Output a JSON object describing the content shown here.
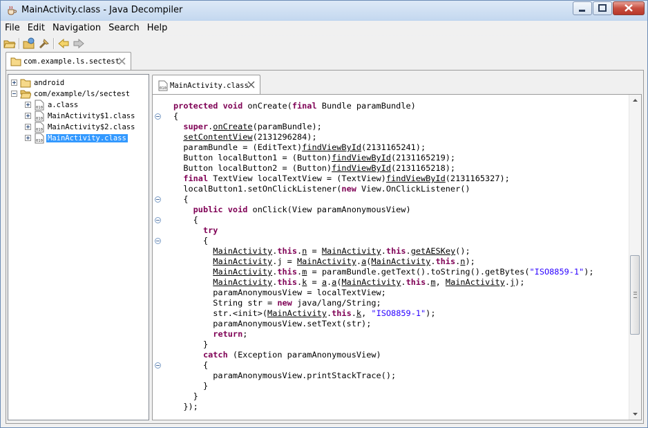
{
  "window": {
    "title": "MainActivity.class - Java Decompiler",
    "minimize_icon": "minimize-icon",
    "maximize_icon": "maximize-icon",
    "close_icon": "close-icon"
  },
  "menu": [
    "File",
    "Edit",
    "Navigation",
    "Search",
    "Help"
  ],
  "toolbar": {
    "icons": [
      "open-file-icon",
      "open-type-icon",
      "find-icon",
      "back-arrow-icon",
      "forward-arrow-icon"
    ]
  },
  "outer_tab": {
    "label": "com.example.ls.sectest"
  },
  "tree": {
    "items": [
      {
        "label": "android",
        "icon": "folder-icon",
        "level": 0,
        "expanded": false,
        "selected": false
      },
      {
        "label": "com/example/ls/sectest",
        "icon": "open-folder-icon",
        "level": 0,
        "expanded": true,
        "selected": false
      },
      {
        "label": "a.class",
        "icon": "class-file-icon",
        "level": 1,
        "expanded": false,
        "selected": false
      },
      {
        "label": "MainActivity$1.class",
        "icon": "class-file-icon",
        "level": 1,
        "expanded": false,
        "selected": false
      },
      {
        "label": "MainActivity$2.class",
        "icon": "class-file-icon",
        "level": 1,
        "expanded": false,
        "selected": false
      },
      {
        "label": "MainActivity.class",
        "icon": "class-file-icon",
        "level": 1,
        "expanded": false,
        "selected": true
      }
    ]
  },
  "editor": {
    "tab_label": "MainActivity.class",
    "fold_lines": [
      1,
      9,
      11,
      13,
      25
    ],
    "code": [
      [
        {
          "t": "protected void",
          "c": "kw"
        },
        {
          "t": " onCreate("
        },
        {
          "t": "final",
          "c": "kw"
        },
        {
          "t": " Bundle paramBundle)"
        }
      ],
      [
        {
          "t": "{"
        }
      ],
      [
        {
          "t": "  "
        },
        {
          "t": "super",
          "c": "kw"
        },
        {
          "t": "."
        },
        {
          "t": "onCreate",
          "c": "link"
        },
        {
          "t": "(paramBundle);"
        }
      ],
      [
        {
          "t": "  "
        },
        {
          "t": "setContentView",
          "c": "link"
        },
        {
          "t": "(2131296284);"
        }
      ],
      [
        {
          "t": "  paramBundle = (EditText)"
        },
        {
          "t": "findViewById",
          "c": "link"
        },
        {
          "t": "(2131165241);"
        }
      ],
      [
        {
          "t": "  Button localButton1 = (Button)"
        },
        {
          "t": "findViewById",
          "c": "link"
        },
        {
          "t": "(2131165219);"
        }
      ],
      [
        {
          "t": "  Button localButton2 = (Button)"
        },
        {
          "t": "findViewById",
          "c": "link"
        },
        {
          "t": "(2131165218);"
        }
      ],
      [
        {
          "t": "  "
        },
        {
          "t": "final",
          "c": "kw"
        },
        {
          "t": " TextView localTextView = (TextView)"
        },
        {
          "t": "findViewById",
          "c": "link"
        },
        {
          "t": "(2131165327);"
        }
      ],
      [
        {
          "t": "  localButton1.setOnClickListener("
        },
        {
          "t": "new",
          "c": "kw"
        },
        {
          "t": " View.OnClickListener()"
        }
      ],
      [
        {
          "t": "  {"
        }
      ],
      [
        {
          "t": "    "
        },
        {
          "t": "public void",
          "c": "kw"
        },
        {
          "t": " onClick(View paramAnonymousView)"
        }
      ],
      [
        {
          "t": "    {"
        }
      ],
      [
        {
          "t": "      "
        },
        {
          "t": "try",
          "c": "kw"
        }
      ],
      [
        {
          "t": "      {"
        }
      ],
      [
        {
          "t": "        "
        },
        {
          "t": "MainActivity",
          "c": "link"
        },
        {
          "t": "."
        },
        {
          "t": "this",
          "c": "kw"
        },
        {
          "t": "."
        },
        {
          "t": "n",
          "c": "link"
        },
        {
          "t": " = "
        },
        {
          "t": "MainActivity",
          "c": "link"
        },
        {
          "t": "."
        },
        {
          "t": "this",
          "c": "kw"
        },
        {
          "t": "."
        },
        {
          "t": "getAESKey",
          "c": "link"
        },
        {
          "t": "();"
        }
      ],
      [
        {
          "t": "        "
        },
        {
          "t": "MainActivity",
          "c": "link"
        },
        {
          "t": ".j = "
        },
        {
          "t": "MainActivity",
          "c": "link"
        },
        {
          "t": "."
        },
        {
          "t": "a",
          "c": "link"
        },
        {
          "t": "("
        },
        {
          "t": "MainActivity",
          "c": "link"
        },
        {
          "t": "."
        },
        {
          "t": "this",
          "c": "kw"
        },
        {
          "t": "."
        },
        {
          "t": "n",
          "c": "link"
        },
        {
          "t": ");"
        }
      ],
      [
        {
          "t": "        "
        },
        {
          "t": "MainActivity",
          "c": "link"
        },
        {
          "t": "."
        },
        {
          "t": "this",
          "c": "kw"
        },
        {
          "t": "."
        },
        {
          "t": "m",
          "c": "link"
        },
        {
          "t": " = paramBundle.getText().toString().getBytes("
        },
        {
          "t": "\"ISO8859-1\"",
          "c": "str"
        },
        {
          "t": ");"
        }
      ],
      [
        {
          "t": "        "
        },
        {
          "t": "MainActivity",
          "c": "link"
        },
        {
          "t": "."
        },
        {
          "t": "this",
          "c": "kw"
        },
        {
          "t": "."
        },
        {
          "t": "k",
          "c": "link"
        },
        {
          "t": " = "
        },
        {
          "t": "a",
          "c": "link"
        },
        {
          "t": "."
        },
        {
          "t": "a",
          "c": "link"
        },
        {
          "t": "("
        },
        {
          "t": "MainActivity",
          "c": "link"
        },
        {
          "t": "."
        },
        {
          "t": "this",
          "c": "kw"
        },
        {
          "t": "."
        },
        {
          "t": "m",
          "c": "link"
        },
        {
          "t": ", "
        },
        {
          "t": "MainActivity",
          "c": "link"
        },
        {
          "t": "."
        },
        {
          "t": "j",
          "c": "link"
        },
        {
          "t": ");"
        }
      ],
      [
        {
          "t": "        paramAnonymousView = localTextView;"
        }
      ],
      [
        {
          "t": "        String str = "
        },
        {
          "t": "new",
          "c": "kw"
        },
        {
          "t": " java/lang/String;"
        }
      ],
      [
        {
          "t": "        str.<init>("
        },
        {
          "t": "MainActivity",
          "c": "link"
        },
        {
          "t": "."
        },
        {
          "t": "this",
          "c": "kw"
        },
        {
          "t": "."
        },
        {
          "t": "k",
          "c": "link"
        },
        {
          "t": ", "
        },
        {
          "t": "\"ISO8859-1\"",
          "c": "str"
        },
        {
          "t": ");"
        }
      ],
      [
        {
          "t": "        paramAnonymousView.setText(str);"
        }
      ],
      [
        {
          "t": "        "
        },
        {
          "t": "return",
          "c": "kw"
        },
        {
          "t": ";"
        }
      ],
      [
        {
          "t": "      }"
        }
      ],
      [
        {
          "t": "      "
        },
        {
          "t": "catch",
          "c": "kw"
        },
        {
          "t": " (Exception paramAnonymousView)"
        }
      ],
      [
        {
          "t": "      {"
        }
      ],
      [
        {
          "t": "        paramAnonymousView.printStackTrace();"
        }
      ],
      [
        {
          "t": "      }"
        }
      ],
      [
        {
          "t": "    }"
        }
      ],
      [
        {
          "t": "  });"
        }
      ]
    ]
  }
}
